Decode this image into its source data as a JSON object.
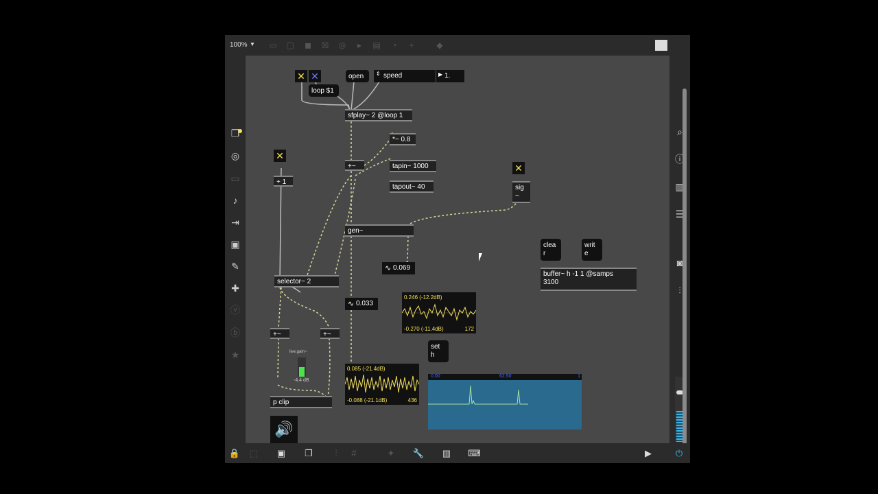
{
  "toolbar": {
    "zoom": "100%"
  },
  "objects": {
    "loop_msg": "loop $1",
    "open_msg": "open",
    "speed_menu": "speed",
    "speed_num": "1.",
    "sfplay": "sfplay~ 2 @loop 1",
    "mul_08": "*~ 0.8",
    "plus_sig": "+~",
    "tapin": "tapin~ 1000",
    "tapout": "tapout~ 40",
    "plus1": "+ 1",
    "sig": "sig\n~",
    "gen": "gen~",
    "num_069": "0.069",
    "num_033": "0.033",
    "selector": "selector~ 2",
    "clear_msg": "clea\nr",
    "write_msg": "writ\ne",
    "buffer": "buffer~ h -1 1 @samps\n3100",
    "plus_l": "+~",
    "plus_r": "+~",
    "live_gain_label": "live.gain~",
    "live_gain_value": "-4.4 dB",
    "pclip": "p clip",
    "set_msg": "set\nh"
  },
  "scopes": {
    "scope1": {
      "top": "0.246 (-12.2dB)",
      "bottom": "-0.270 (-11.4dB)",
      "count": "172"
    },
    "scope2": {
      "top": "0.085 (-21.4dB)",
      "bottom": "-0.088 (-21.1dB)",
      "count": "436"
    }
  },
  "waveform": {
    "start": "0.00",
    "mid": "62.50",
    "end": "1"
  },
  "colors": {
    "accent": "#f4e05a",
    "canvas": "#484848",
    "patchcord": "#d8d89a",
    "waveform_bg": "#2a6a8e"
  }
}
